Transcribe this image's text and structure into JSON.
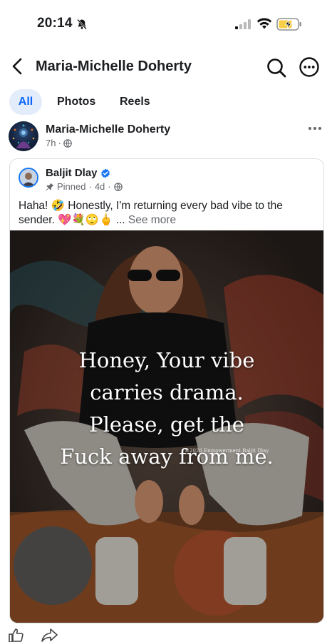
{
  "status_bar": {
    "time": "20:14"
  },
  "header": {
    "title": "Maria-Michelle Doherty"
  },
  "tabs": [
    {
      "label": "All",
      "active": true
    },
    {
      "label": "Photos",
      "active": false
    },
    {
      "label": "Reels",
      "active": false
    }
  ],
  "post": {
    "author": "Maria-Michelle Doherty",
    "time": "7h",
    "separator": "·",
    "shared": {
      "author": "Baljit Dlay",
      "pinned_label": "Pinned",
      "time": "4d",
      "text": "Haha! 🤣 Honestly, I'm returning every bad vibe to the sender. 💖💐🙄🖕 ...",
      "see_more": "See more",
      "image_quote": [
        "Honey, Your vibe",
        "carries drama.",
        "Please, get the",
        "Fuck away from me."
      ],
      "watermark": "©2026 Empowerment Baljit Dlay"
    }
  },
  "colors": {
    "accent": "#0866ff",
    "tab_bg": "#e3ecfb",
    "muted": "#65676b",
    "verified": "#1877f2"
  }
}
